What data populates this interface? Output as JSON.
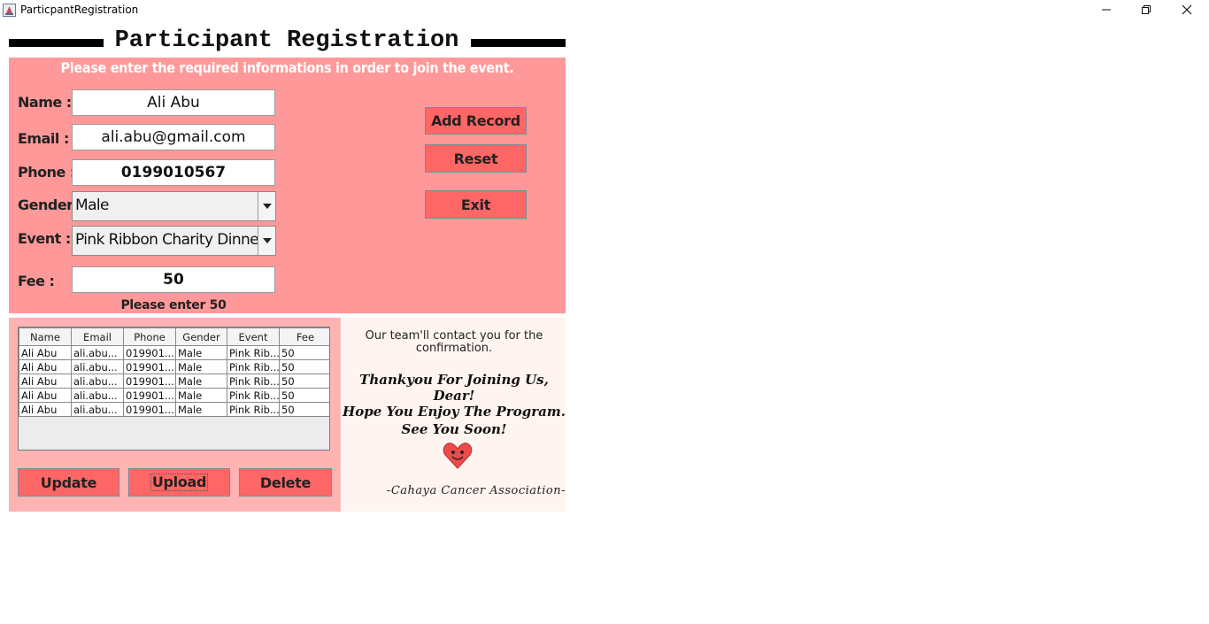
{
  "window": {
    "title": "ParticpantRegistration",
    "controls": [
      "minimize",
      "restore",
      "close"
    ]
  },
  "header": {
    "title": "Participant Registration",
    "subtitle": "Please enter the required informations in order to join the event."
  },
  "form": {
    "name_label": "Name :",
    "name_value": "Ali Abu",
    "email_label": "Email :",
    "email_value": "ali.abu@gmail.com",
    "phone_label": "Phone :",
    "phone_value": "0199010567",
    "gender_label": "Gender :",
    "gender_value": "Male",
    "event_label": "Event :",
    "event_value": "Pink Ribbon Charity Dinner",
    "fee_label": "Fee :",
    "fee_value": "50",
    "fee_hint": "Please enter 50"
  },
  "actions": {
    "add_record": "Add Record",
    "reset": "Reset",
    "exit": "Exit",
    "update": "Update",
    "upload": "Upload",
    "delete": "Delete"
  },
  "table": {
    "columns": [
      "Name",
      "Email",
      "Phone",
      "Gender",
      "Event",
      "Fee"
    ],
    "rows": [
      [
        "Ali Abu",
        "ali.abu...",
        "019901...",
        "Male",
        "Pink Rib...",
        "50"
      ],
      [
        "Ali Abu",
        "ali.abu...",
        "019901...",
        "Male",
        "Pink Rib...",
        "50"
      ],
      [
        "Ali Abu",
        "ali.abu...",
        "019901...",
        "Male",
        "Pink Rib...",
        "50"
      ],
      [
        "Ali Abu",
        "ali.abu...",
        "019901...",
        "Male",
        "Pink Rib...",
        "50"
      ],
      [
        "Ali Abu",
        "ali.abu...",
        "019901...",
        "Male",
        "Pink Rib...",
        "50"
      ]
    ]
  },
  "message": {
    "contact_line1": "Our team'll contact you for the",
    "contact_line2": "confirmation.",
    "thanks_line1": "Thankyou For Joining Us, Dear!",
    "thanks_line2": "Hope You Enjoy The Program.",
    "see_you": "See You Soon!",
    "signature": "-Cahaya Cancer Association-"
  },
  "colors": {
    "panel_pink": "#ff9999",
    "button_red": "#ff6666",
    "table_panel": "#ffb3b3",
    "message_panel": "#fff4f0",
    "heart": "#ee4b4b"
  },
  "icons": [
    "java-app-icon",
    "minimize-icon",
    "restore-icon",
    "close-icon",
    "dropdown-arrow-icon",
    "heart-smiley-icon"
  ]
}
